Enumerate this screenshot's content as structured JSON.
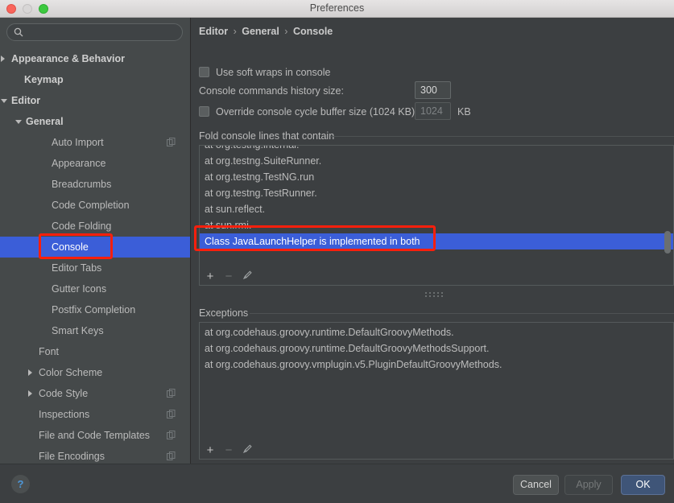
{
  "window": {
    "title": "Preferences",
    "traffic_lights": [
      "close-button",
      "minimize-button",
      "zoom-button"
    ]
  },
  "sidebar": {
    "search": {
      "value": "",
      "placeholder": "",
      "icon": "search-icon"
    },
    "items": [
      {
        "label": "Appearance & Behavior",
        "indent": 14,
        "arrow": "right",
        "bold": true,
        "selected": false,
        "copy_icon": false
      },
      {
        "label": "Keymap",
        "indent": 30,
        "arrow": "none",
        "bold": true,
        "selected": false,
        "copy_icon": false
      },
      {
        "label": "Editor",
        "indent": 14,
        "arrow": "down",
        "bold": true,
        "selected": false,
        "copy_icon": false
      },
      {
        "label": "General",
        "indent": 32,
        "arrow": "down",
        "bold": true,
        "selected": false,
        "copy_icon": false
      },
      {
        "label": "Auto Import",
        "indent": 64,
        "arrow": "none",
        "bold": false,
        "selected": false,
        "copy_icon": true
      },
      {
        "label": "Appearance",
        "indent": 64,
        "arrow": "none",
        "bold": false,
        "selected": false,
        "copy_icon": false
      },
      {
        "label": "Breadcrumbs",
        "indent": 64,
        "arrow": "none",
        "bold": false,
        "selected": false,
        "copy_icon": false
      },
      {
        "label": "Code Completion",
        "indent": 64,
        "arrow": "none",
        "bold": false,
        "selected": false,
        "copy_icon": false
      },
      {
        "label": "Code Folding",
        "indent": 64,
        "arrow": "none",
        "bold": false,
        "selected": false,
        "copy_icon": false
      },
      {
        "label": "Console",
        "indent": 64,
        "arrow": "none",
        "bold": false,
        "selected": true,
        "copy_icon": false
      },
      {
        "label": "Editor Tabs",
        "indent": 64,
        "arrow": "none",
        "bold": false,
        "selected": false,
        "copy_icon": false
      },
      {
        "label": "Gutter Icons",
        "indent": 64,
        "arrow": "none",
        "bold": false,
        "selected": false,
        "copy_icon": false
      },
      {
        "label": "Postfix Completion",
        "indent": 64,
        "arrow": "none",
        "bold": false,
        "selected": false,
        "copy_icon": false
      },
      {
        "label": "Smart Keys",
        "indent": 64,
        "arrow": "none",
        "bold": false,
        "selected": false,
        "copy_icon": false
      },
      {
        "label": "Font",
        "indent": 48,
        "arrow": "none",
        "bold": false,
        "selected": false,
        "copy_icon": false
      },
      {
        "label": "Color Scheme",
        "indent": 48,
        "arrow": "right",
        "bold": false,
        "selected": false,
        "copy_icon": false
      },
      {
        "label": "Code Style",
        "indent": 48,
        "arrow": "right",
        "bold": false,
        "selected": false,
        "copy_icon": true
      },
      {
        "label": "Inspections",
        "indent": 48,
        "arrow": "none",
        "bold": false,
        "selected": false,
        "copy_icon": true
      },
      {
        "label": "File and Code Templates",
        "indent": 48,
        "arrow": "none",
        "bold": false,
        "selected": false,
        "copy_icon": true
      },
      {
        "label": "File Encodings",
        "indent": 48,
        "arrow": "none",
        "bold": false,
        "selected": false,
        "copy_icon": true
      }
    ]
  },
  "main": {
    "breadcrumb": {
      "root": "Editor",
      "middle": "General",
      "leaf": "Console",
      "separator": "›"
    },
    "soft_wraps": {
      "label": "Use soft wraps in console",
      "checked": false
    },
    "history": {
      "label": "Console commands history size:",
      "value": "300"
    },
    "override_buffer": {
      "label": "Override console cycle buffer size (1024 KB)",
      "checked": false,
      "value": "1024",
      "unit": "KB",
      "disabled": true
    },
    "fold_section": {
      "title": "Fold console lines that contain",
      "rows": [
        {
          "text": "at org.testng.internal.",
          "selected": false
        },
        {
          "text": "at org.testng.SuiteRunner.",
          "selected": false
        },
        {
          "text": "at org.testng.TestNG.run",
          "selected": false
        },
        {
          "text": "at org.testng.TestRunner.",
          "selected": false
        },
        {
          "text": "at sun.reflect.",
          "selected": false
        },
        {
          "text": "at sun.rmi.",
          "selected": false
        },
        {
          "text": "Class JavaLaunchHelper is implemented in both",
          "selected": true
        }
      ],
      "toolbar": {
        "add": "+",
        "remove": "−",
        "edit": "pencil-icon"
      }
    },
    "exceptions_section": {
      "title": "Exceptions",
      "rows": [
        {
          "text": "at org.codehaus.groovy.runtime.DefaultGroovyMethods.",
          "selected": false
        },
        {
          "text": "at org.codehaus.groovy.runtime.DefaultGroovyMethodsSupport.",
          "selected": false
        },
        {
          "text": "at org.codehaus.groovy.vmplugin.v5.PluginDefaultGroovyMethods.",
          "selected": false
        }
      ],
      "toolbar": {
        "add": "+",
        "remove": "−",
        "edit": "pencil-icon"
      }
    }
  },
  "footer": {
    "help": "?",
    "cancel": "Cancel",
    "apply": "Apply",
    "ok": "OK"
  },
  "annotations": [
    {
      "name": "console-sidebar-highlight",
      "color": "#fb1f0c"
    },
    {
      "name": "fold-rule-highlight",
      "color": "#fb1f0c"
    }
  ],
  "colors": {
    "accent_selection": "#3b5ed8",
    "annotation_red": "#fb1f0c",
    "panel_bg": "#3c3f41",
    "sidebar_bg": "#45494a",
    "ok_button": "#3f5578",
    "help_glyph": "#4d97d8"
  }
}
